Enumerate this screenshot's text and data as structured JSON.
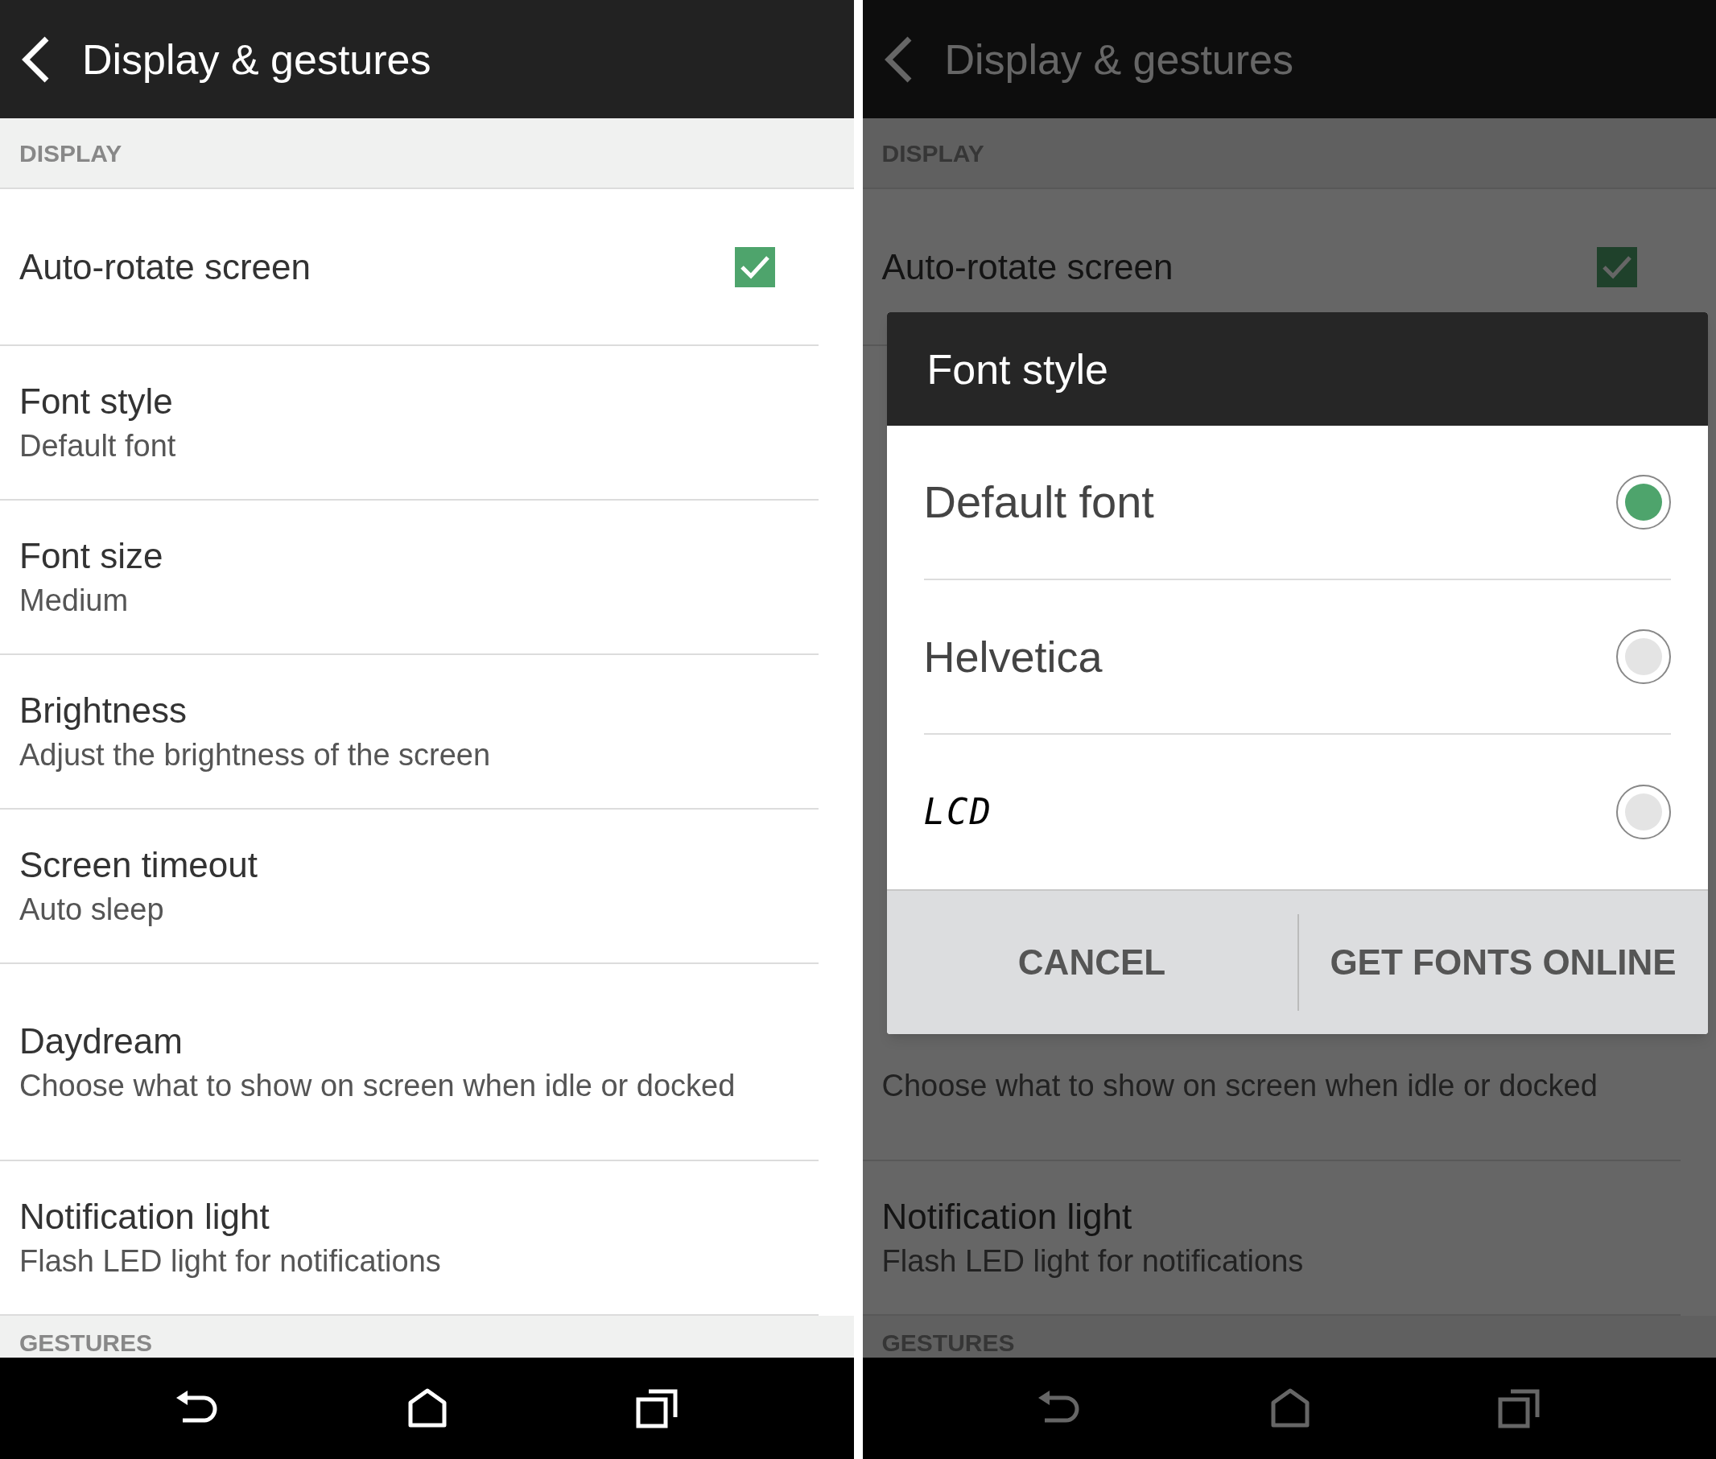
{
  "screens": [
    {
      "title": "Display & gestures",
      "section": "DISPLAY",
      "items": [
        {
          "kind": "checkbox",
          "title": "Auto-rotate screen",
          "checked": true
        },
        {
          "kind": "setting",
          "title": "Font style",
          "subtitle": "Default font"
        },
        {
          "kind": "setting",
          "title": "Font size",
          "subtitle": "Medium"
        },
        {
          "kind": "setting",
          "title": "Brightness",
          "subtitle": "Adjust the brightness of the screen"
        },
        {
          "kind": "setting",
          "title": "Screen timeout",
          "subtitle": "Auto sleep"
        },
        {
          "kind": "setting",
          "title": "Daydream",
          "subtitle": "Choose what to show on screen when idle or docked"
        },
        {
          "kind": "setting",
          "title": "Notification light",
          "subtitle": "Flash LED light for notifications"
        }
      ],
      "footer_section": "GESTURES"
    },
    {
      "title": "Display & gestures",
      "section": "DISPLAY",
      "items": [
        {
          "kind": "checkbox",
          "title": "Auto-rotate screen",
          "checked": true
        },
        {
          "kind": "setting",
          "subtitle": "Choose what to show on screen when idle or docked"
        },
        {
          "kind": "setting",
          "title": "Notification light",
          "subtitle": "Flash LED light for notifications"
        }
      ],
      "footer_section": "GESTURES",
      "dialog": {
        "title": "Font style",
        "options": [
          {
            "label": "Default font",
            "kind": "regular",
            "selected": true
          },
          {
            "label": "Helvetica",
            "kind": "thin",
            "selected": false
          },
          {
            "label": "LCD",
            "kind": "lcd",
            "selected": false
          }
        ],
        "buttons": [
          "CANCEL",
          "GET FONTS ONLINE"
        ]
      }
    }
  ]
}
